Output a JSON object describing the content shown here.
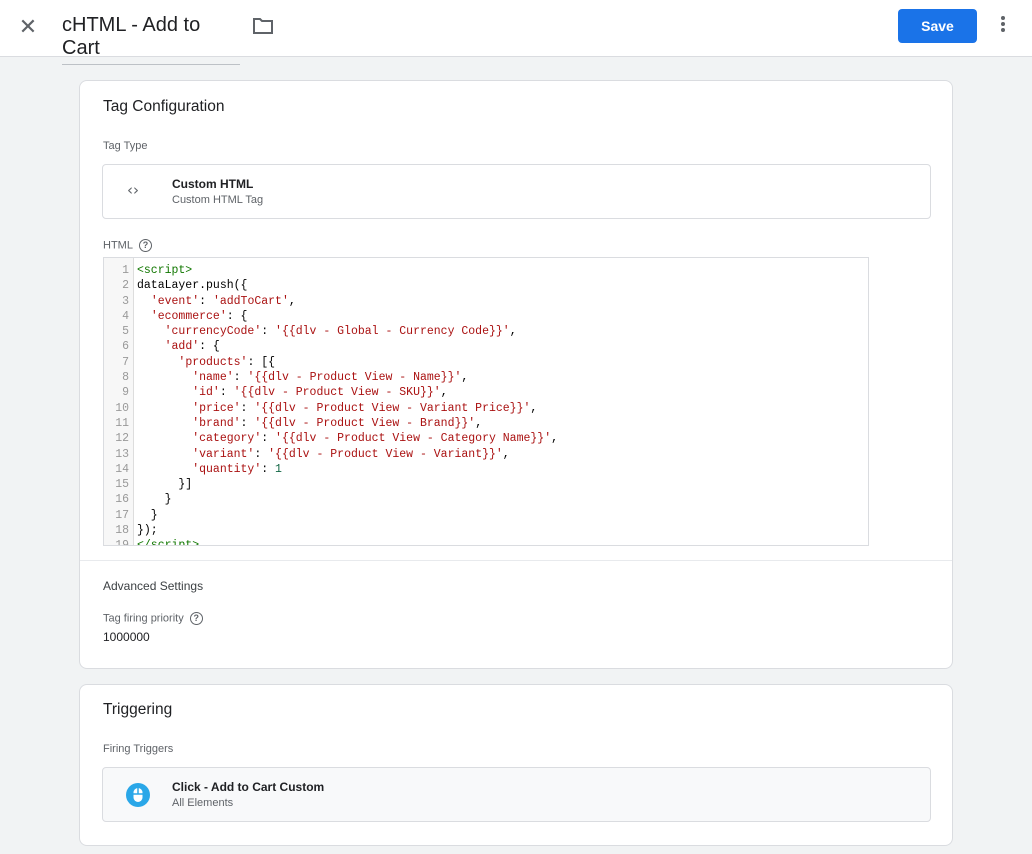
{
  "header": {
    "title": "cHTML - Add to Cart",
    "save_label": "Save"
  },
  "tag_config": {
    "heading": "Tag Configuration",
    "tag_type_label": "Tag Type",
    "tag_type_name": "Custom HTML",
    "tag_type_sub": "Custom HTML Tag",
    "html_label": "HTML",
    "code_lines": [
      [
        {
          "t": "<script>",
          "c": "tag"
        }
      ],
      [
        {
          "t": "dataLayer.push({",
          "c": "plain"
        }
      ],
      [
        {
          "t": "  ",
          "c": "plain"
        },
        {
          "t": "'event'",
          "c": "str"
        },
        {
          "t": ": ",
          "c": "plain"
        },
        {
          "t": "'addToCart'",
          "c": "str"
        },
        {
          "t": ",",
          "c": "plain"
        }
      ],
      [
        {
          "t": "  ",
          "c": "plain"
        },
        {
          "t": "'ecommerce'",
          "c": "str"
        },
        {
          "t": ": {",
          "c": "plain"
        }
      ],
      [
        {
          "t": "    ",
          "c": "plain"
        },
        {
          "t": "'currencyCode'",
          "c": "str"
        },
        {
          "t": ": ",
          "c": "plain"
        },
        {
          "t": "'{{dlv - Global - Currency Code}}'",
          "c": "str"
        },
        {
          "t": ",",
          "c": "plain"
        }
      ],
      [
        {
          "t": "    ",
          "c": "plain"
        },
        {
          "t": "'add'",
          "c": "str"
        },
        {
          "t": ": {",
          "c": "plain"
        }
      ],
      [
        {
          "t": "      ",
          "c": "plain"
        },
        {
          "t": "'products'",
          "c": "str"
        },
        {
          "t": ": [{",
          "c": "plain"
        }
      ],
      [
        {
          "t": "        ",
          "c": "plain"
        },
        {
          "t": "'name'",
          "c": "str"
        },
        {
          "t": ": ",
          "c": "plain"
        },
        {
          "t": "'{{dlv - Product View - Name}}'",
          "c": "str"
        },
        {
          "t": ",",
          "c": "plain"
        }
      ],
      [
        {
          "t": "        ",
          "c": "plain"
        },
        {
          "t": "'id'",
          "c": "str"
        },
        {
          "t": ": ",
          "c": "plain"
        },
        {
          "t": "'{{dlv - Product View - SKU}}'",
          "c": "str"
        },
        {
          "t": ",",
          "c": "plain"
        }
      ],
      [
        {
          "t": "        ",
          "c": "plain"
        },
        {
          "t": "'price'",
          "c": "str"
        },
        {
          "t": ": ",
          "c": "plain"
        },
        {
          "t": "'{{dlv - Product View - Variant Price}}'",
          "c": "str"
        },
        {
          "t": ",",
          "c": "plain"
        }
      ],
      [
        {
          "t": "        ",
          "c": "plain"
        },
        {
          "t": "'brand'",
          "c": "str"
        },
        {
          "t": ": ",
          "c": "plain"
        },
        {
          "t": "'{{dlv - Product View - Brand}}'",
          "c": "str"
        },
        {
          "t": ",",
          "c": "plain"
        }
      ],
      [
        {
          "t": "        ",
          "c": "plain"
        },
        {
          "t": "'category'",
          "c": "str"
        },
        {
          "t": ": ",
          "c": "plain"
        },
        {
          "t": "'{{dlv - Product View - Category Name}}'",
          "c": "str"
        },
        {
          "t": ",",
          "c": "plain"
        }
      ],
      [
        {
          "t": "        ",
          "c": "plain"
        },
        {
          "t": "'variant'",
          "c": "str"
        },
        {
          "t": ": ",
          "c": "plain"
        },
        {
          "t": "'{{dlv - Product View - Variant}}'",
          "c": "str"
        },
        {
          "t": ",",
          "c": "plain"
        }
      ],
      [
        {
          "t": "        ",
          "c": "plain"
        },
        {
          "t": "'quantity'",
          "c": "str"
        },
        {
          "t": ": ",
          "c": "plain"
        },
        {
          "t": "1",
          "c": "num"
        }
      ],
      [
        {
          "t": "      }]",
          "c": "plain"
        }
      ],
      [
        {
          "t": "    }",
          "c": "plain"
        }
      ],
      [
        {
          "t": "  }",
          "c": "plain"
        }
      ],
      [
        {
          "t": "});",
          "c": "plain"
        }
      ],
      [
        {
          "t": "</script>",
          "c": "tag"
        }
      ]
    ],
    "advanced_label": "Advanced Settings",
    "priority_label": "Tag firing priority",
    "priority_value": "1000000"
  },
  "triggering": {
    "heading": "Triggering",
    "firing_label": "Firing Triggers",
    "trigger_name": "Click - Add to Cart Custom",
    "trigger_sub": "All Elements"
  }
}
